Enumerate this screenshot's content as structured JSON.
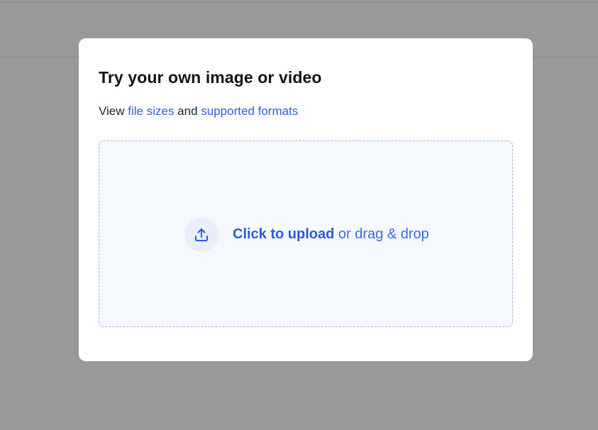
{
  "modal": {
    "title": "Try your own image or video",
    "subtitle": {
      "prefix": "View ",
      "link1": "file sizes",
      "middle": " and ",
      "link2": "supported formats"
    },
    "dropzone": {
      "icon": "upload-icon",
      "action": "Click to upload",
      "rest": " or drag & drop"
    }
  },
  "colors": {
    "link": "#2f5fd8",
    "accent": "#2a5bdc",
    "dropzone_bg": "#f5f8fd",
    "backdrop": "#999999"
  }
}
